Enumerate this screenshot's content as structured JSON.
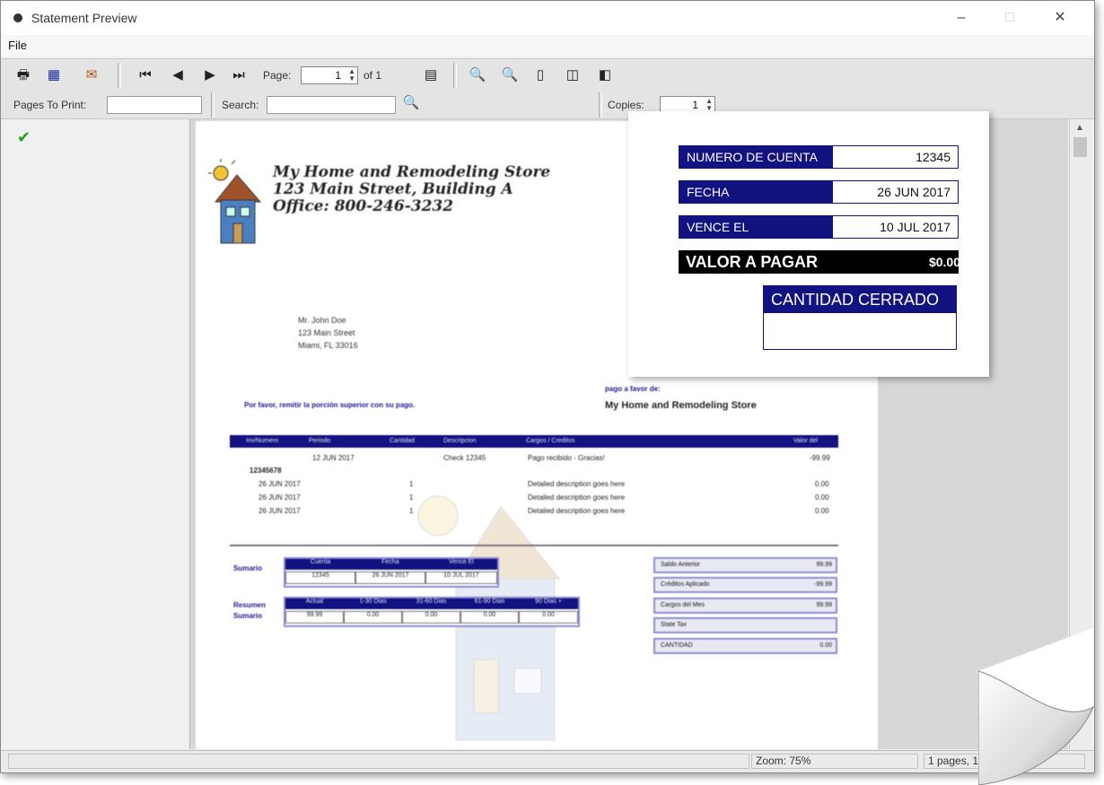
{
  "window": {
    "title": "Statement Preview",
    "minimize": "–",
    "maximize": "□",
    "close": "✕"
  },
  "menu": {
    "file": "File"
  },
  "toolbar": {
    "page_label": "Page:",
    "page_value": "1",
    "page_of": "of 1",
    "copies_label": "Copies:",
    "copies_value": "1",
    "pages_to_print_label": "Pages To Print:",
    "search_label": "Search:"
  },
  "document": {
    "store_lines": [
      "My Home and Remodeling Store",
      "123 Main Street, Building A",
      "Office: 800-246-3232"
    ],
    "customer": [
      "Mr. John Doe",
      "123 Main Street",
      "Miami, FL 33016"
    ],
    "remit_note": "Por favor, remitir la porción superior con su pago.",
    "pay_to_label": "pago a favor de:",
    "pay_to_name": "My Home and Remodeling Store",
    "table_headers": [
      "Inv/Numero",
      "Periodo",
      "Cantidad",
      "Descripcion",
      "Cargos / Creditos",
      "Valor del"
    ],
    "rows": [
      {
        "date": "12 JUN 2017",
        "qty": "",
        "desc": "Check 12345",
        "charge": "Pago recibido - Gracias!",
        "amount": "-99.99"
      },
      {
        "date": "12345678",
        "qty": "",
        "desc": "",
        "charge": "",
        "amount": ""
      },
      {
        "date": "26 JUN 2017",
        "qty": "1",
        "desc": "",
        "charge": "Detailed description goes here",
        "amount": "0.00"
      },
      {
        "date": "26 JUN 2017",
        "qty": "1",
        "desc": "",
        "charge": "Detailed description goes here",
        "amount": "0.00"
      },
      {
        "date": "26 JUN 2017",
        "qty": "1",
        "desc": "",
        "charge": "Detailed description goes here",
        "amount": "0.00"
      }
    ],
    "summary_label": "Sumario",
    "summary_headers": [
      "Cuenta",
      "Fecha",
      "Vence El"
    ],
    "summary_values": [
      "12345",
      "26 JUN 2017",
      "10 JUL 2017"
    ],
    "resumen_label": "Resumen Sumario",
    "aging_headers": [
      "Actual",
      "1-30 Dias",
      "31-60 Dias",
      "61-90 Dias",
      "90 Dias +"
    ],
    "aging_values": [
      "99.99",
      "0.00",
      "0.00",
      "0.00",
      "0.00"
    ],
    "right_boxes": [
      {
        "label": "Saldo Anterior",
        "value": "99.99"
      },
      {
        "label": "Créditos Aplicado",
        "value": "-99.99"
      },
      {
        "label": "Cargos del Mes",
        "value": "99.99"
      },
      {
        "label": "State Tax",
        "value": ""
      },
      {
        "label": "CANTIDAD",
        "value": "0.00"
      }
    ]
  },
  "popup": {
    "account_label": "NUMERO DE CUENTA",
    "account_value": "12345",
    "date_label": "FECHA",
    "date_value": "26 JUN 2017",
    "due_label": "VENCE EL",
    "due_value": "10 JUL 2017",
    "pay_label": "VALOR A PAGAR",
    "pay_value": "$0.00",
    "closed_label": "CANTIDAD CERRADO"
  },
  "status": {
    "zoom": "Zoom: 75%",
    "pages": "1 pages, 13"
  },
  "colors": {
    "navy": "#121280",
    "page_bg": "#ffffff",
    "viewer_bg": "#d7d7d7",
    "check_green": "#2e9a2e"
  },
  "icons": [
    "print-icon",
    "export-icon",
    "email-icon",
    "first-page-icon",
    "prev-page-icon",
    "next-page-icon",
    "last-page-icon",
    "thumbnails-icon",
    "zoom-in-icon",
    "zoom-out-icon",
    "single-page-icon",
    "two-page-icon",
    "page-width-icon",
    "search-icon",
    "checkmark-icon"
  ]
}
